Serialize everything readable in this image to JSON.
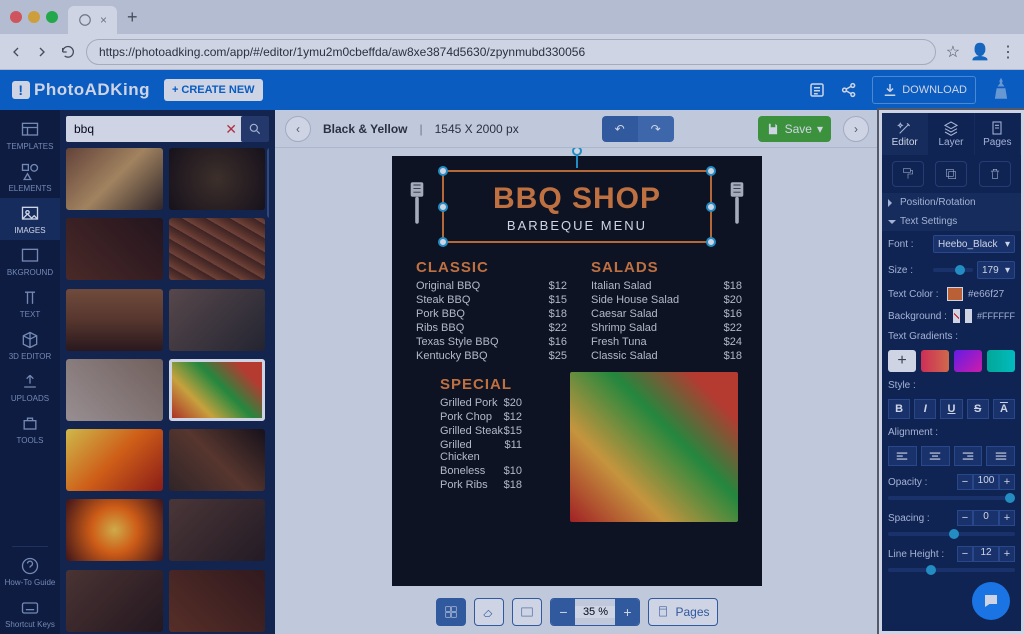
{
  "browser": {
    "url": "https://photoadking.com/app/#/editor/1ymu2m0cbeffda/aw8xe3874d5630/zpynmubd330056"
  },
  "app": {
    "logo_text": "PhotoADKing",
    "create_new": "CREATE NEW",
    "download": "DOWNLOAD"
  },
  "rail": {
    "items": [
      "TEMPLATES",
      "ELEMENTS",
      "IMAGES",
      "BKGROUND",
      "TEXT",
      "3D EDITOR",
      "UPLOADS",
      "TOOLS"
    ],
    "footer": [
      "How-To Guide",
      "Shortcut Keys"
    ],
    "active_index": 2
  },
  "search": {
    "value": "bbq"
  },
  "canvasbar": {
    "project_name": "Black & Yellow",
    "dimensions": "1545 X 2000 px",
    "save": "Save"
  },
  "menu": {
    "title": "BBQ SHOP",
    "subtitle": "BARBEQUE MENU",
    "sections": {
      "classic": {
        "heading": "CLASSIC",
        "items": [
          {
            "n": "Original BBQ",
            "p": "$12"
          },
          {
            "n": "Steak BBQ",
            "p": "$15"
          },
          {
            "n": "Pork BBQ",
            "p": "$18"
          },
          {
            "n": "Ribs BBQ",
            "p": "$22"
          },
          {
            "n": "Texas Style BBQ",
            "p": "$16"
          },
          {
            "n": "Kentucky BBQ",
            "p": "$25"
          }
        ]
      },
      "salads": {
        "heading": "SALADS",
        "items": [
          {
            "n": "Italian Salad",
            "p": "$18"
          },
          {
            "n": "Side House Salad",
            "p": "$20"
          },
          {
            "n": "Caesar Salad",
            "p": "$16"
          },
          {
            "n": "Shrimp Salad",
            "p": "$22"
          },
          {
            "n": "Fresh Tuna",
            "p": "$24"
          },
          {
            "n": "Classic Salad",
            "p": "$18"
          }
        ]
      },
      "special": {
        "heading": "SPECIAL",
        "items": [
          {
            "n": "Grilled Pork",
            "p": "$20"
          },
          {
            "n": "Pork Chop",
            "p": "$12"
          },
          {
            "n": "Grilled Steak",
            "p": "$15"
          },
          {
            "n": "Grilled Chicken",
            "p": "$11"
          },
          {
            "n": "Boneless",
            "p": "$10"
          },
          {
            "n": "Pork Ribs",
            "p": "$18"
          }
        ]
      }
    }
  },
  "bottombar": {
    "zoom": "35 %",
    "pages": "Pages"
  },
  "props": {
    "tabs": [
      "Editor",
      "Layer",
      "Pages"
    ],
    "section_pos": "Position/Rotation",
    "section_text": "Text Settings",
    "font_label": "Font :",
    "font_value": "Heebo_Black",
    "size_label": "Size :",
    "size_value": "179",
    "textcolor_label": "Text Color :",
    "textcolor_hex": "#e66f27",
    "bg_label": "Background :",
    "bg_hex": "#FFFFFF",
    "gradients_label": "Text Gradients :",
    "style_label": "Style :",
    "align_label": "Alignment :",
    "opacity_label": "Opacity :",
    "opacity_value": "100",
    "spacing_label": "Spacing :",
    "spacing_value": "0",
    "lineheight_label": "Line Height :",
    "lineheight_value": "12"
  }
}
